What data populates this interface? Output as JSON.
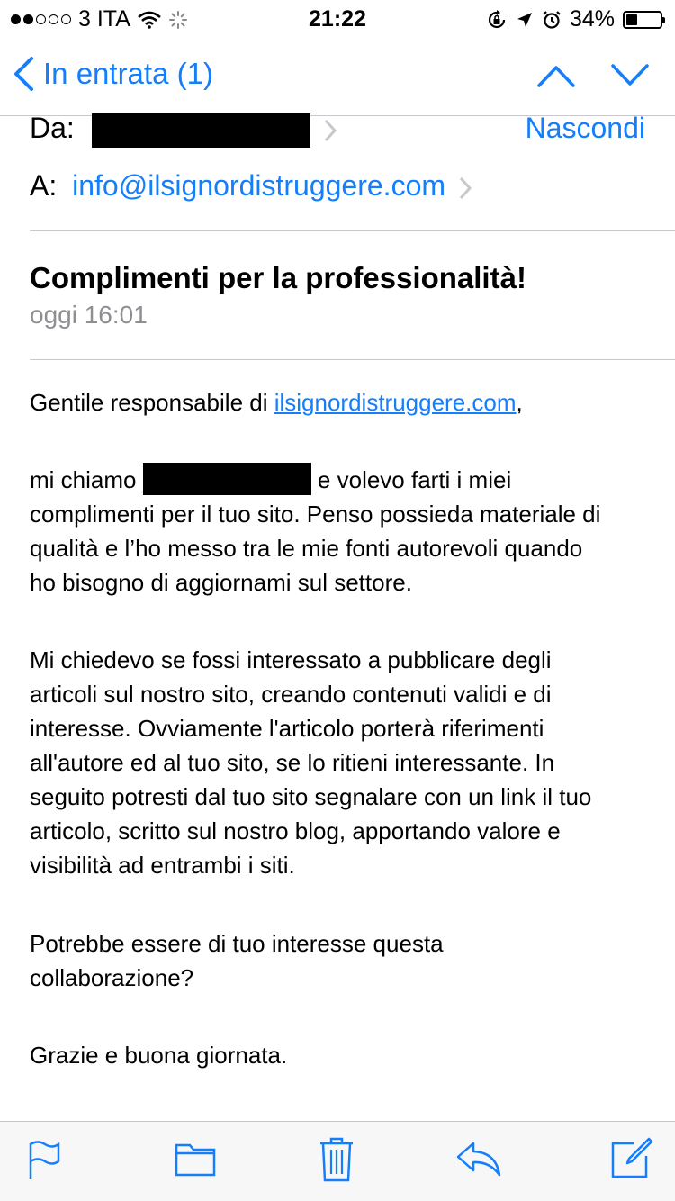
{
  "status_bar": {
    "carrier": "3 ITA",
    "time": "21:22",
    "battery": "34%",
    "battery_level": 0.34,
    "signal_bars_filled": 2,
    "signal_bars_total": 5
  },
  "nav": {
    "back_label": "In entrata (1)",
    "accent_color": "#157efb"
  },
  "header": {
    "from_label": "Da:",
    "to_label": "A:",
    "to_address": "info@ilsignordistruggere.com",
    "hide_label": "Nascondi"
  },
  "message": {
    "subject": "Complimenti per la professionalità!",
    "date": "oggi 16:01",
    "greeting_prefix": "Gentile responsabile di ",
    "greeting_link": "ilsignordistruggere.com",
    "greeting_suffix": ",",
    "p1_prefix": "mi chiamo ",
    "p1_rest_line1": " e volevo farti i miei",
    "p1_lines": [
      "complimenti per il tuo sito. Penso possieda materiale di",
      "qualità e l’ho messo tra le mie fonti autorevoli quando",
      "ho bisogno di aggiornami sul settore."
    ],
    "p2_lines": [
      "Mi chiedevo se fossi interessato a pubblicare degli",
      "articoli sul nostro sito, creando contenuti validi e di",
      "interesse. Ovviamente l'articolo porterà riferimenti",
      "all'autore ed al tuo sito, se lo ritieni interessante. In",
      "seguito potresti dal tuo sito segnalare con un link il tuo",
      "articolo, scritto sul nostro blog, apportando valore e",
      "visibilità ad entrambi i siti."
    ],
    "p3_lines": [
      "Potrebbe essere di tuo interesse questa",
      "collaborazione?"
    ],
    "closing": "Grazie e buona giornata."
  },
  "toolbar": {
    "icons": [
      "flag-icon",
      "folder-icon",
      "trash-icon",
      "reply-icon",
      "compose-icon"
    ]
  }
}
